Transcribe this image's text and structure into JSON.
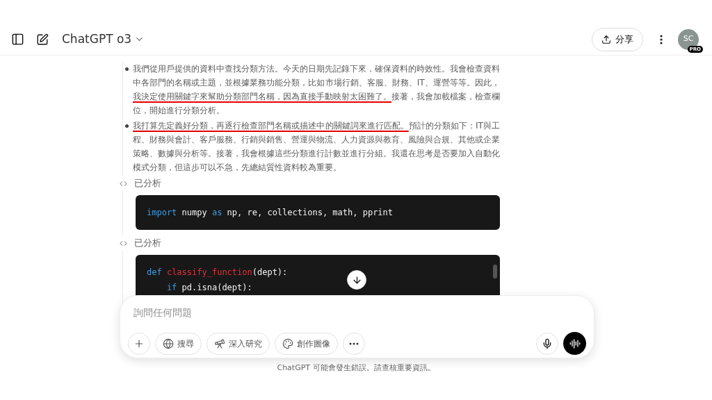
{
  "header": {
    "model": "ChatGPT o3",
    "share": "分享",
    "avatar": "SC",
    "badge": "PRO"
  },
  "bullets": [
    {
      "segments": [
        {
          "text": "我們從用戶提供的資料中查找分類方法。今天的日期先記錄下來，確保資料的時效性。我會檢查資料中各部門的名稱或主題，並根據業務功能分類，比如市場行銷、客服、財務、IT、運營等等。因此，",
          "underlined": false
        },
        {
          "text": "我決定使用關鍵字來幫助分類部門名稱，因為直接手動映射太困難了。",
          "underlined": true
        },
        {
          "text": "接著，我會加載檔案，檢查欄位，開始進行分類分析。",
          "underlined": false
        }
      ]
    },
    {
      "segments": [
        {
          "text": "我打算先定義好分類，再逐行檢查部門名稱或描述中的關鍵詞來進行匹配。",
          "underlined": true
        },
        {
          "text": "預計的分類如下：IT與工程、財務與會計、客戶服務、行銷與銷售、營運與物流、人力資源與教育、風險與合規、其他或企業策略、數據與分析等。接著，我會根據這些分類進行計數並進行分組。我還在思考是否要加入自動化模式分類，但這步可以不急，先總結質性資料較為重要。",
          "underlined": false
        }
      ]
    }
  ],
  "code_blocks": [
    {
      "label": "已分析",
      "scrollbar": false,
      "lines": [
        [
          {
            "text": "import",
            "kind": "keyword"
          },
          {
            "text": " numpy ",
            "kind": "plain"
          },
          {
            "text": "as",
            "kind": "keyword"
          },
          {
            "text": " np, re, collections, math, pprint",
            "kind": "plain"
          }
        ]
      ]
    },
    {
      "label": "已分析",
      "scrollbar": true,
      "lines": [
        [
          {
            "text": "def",
            "kind": "keyword"
          },
          {
            "text": " classify_function",
            "kind": "function"
          },
          {
            "text": "(dept):",
            "kind": "plain"
          }
        ],
        [
          {
            "text": "    if",
            "kind": "keyword"
          },
          {
            "text": " pd.isna(dept):",
            "kind": "plain"
          }
        ]
      ]
    }
  ],
  "composer": {
    "placeholder": "詢問任何問題",
    "tools": [
      {
        "kind": "plus"
      },
      {
        "kind": "globe",
        "label": "搜尋"
      },
      {
        "kind": "telescope",
        "label": "深入研究"
      },
      {
        "kind": "palette",
        "label": "創作圖像"
      },
      {
        "kind": "more"
      }
    ]
  },
  "footer": "ChatGPT 可能會發生錯誤。請查核重要資訊。"
}
